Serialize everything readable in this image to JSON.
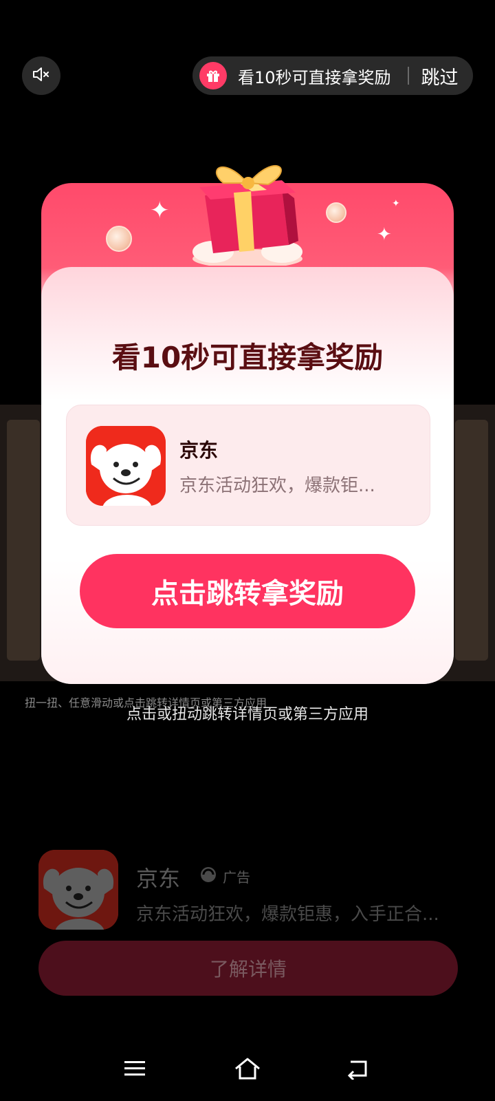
{
  "top": {
    "reward_text": "看10秒可直接拿奖励",
    "skip_label": "跳过"
  },
  "modal": {
    "title": "看10秒可直接拿奖励",
    "app_name": "京东",
    "app_desc": "京东活动狂欢，爆款钜...",
    "cta_label": "点击跳转拿奖励"
  },
  "hint_text": "点击或扭动跳转详情页或第三方应用",
  "background_caption": "扭一扭、任意滑动或点击跳转详情页或第三方应用",
  "bottom": {
    "app_name": "京东",
    "ad_label": "广告",
    "app_desc": "京东活动狂欢，爆款钜惠，入手正合...",
    "button_label": "了解详情"
  },
  "icons": {
    "mute": "speaker-muted-icon",
    "gift": "gift-icon",
    "menu": "menu-icon",
    "home": "home-icon",
    "back": "back-icon"
  },
  "colors": {
    "accent": "#ff3360",
    "title": "#5a0e12"
  }
}
